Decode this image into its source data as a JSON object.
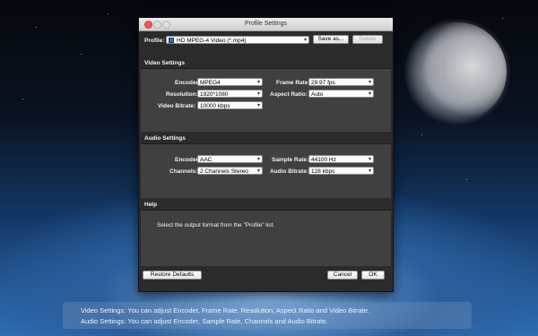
{
  "window": {
    "title": "Profile Settings"
  },
  "profile": {
    "label": "Profile:",
    "value": "HD MPEG-4 Video (*.mp4)",
    "save_as": "Save as...",
    "delete": "Delete"
  },
  "video": {
    "title": "Video Settings",
    "encoder_label": "Encoder:",
    "encoder": "MPEG4",
    "resolution_label": "Resolution:",
    "resolution": "1920*1080",
    "bitrate_label": "Video Bitrate:",
    "bitrate": "10000 kbps",
    "framerate_label": "Frame Rate:",
    "framerate": "29.97 fps",
    "aspect_label": "Aspect Ratio:",
    "aspect": "Auto"
  },
  "audio": {
    "title": "Audio Settings",
    "encoder_label": "Encoder:",
    "encoder": "AAC",
    "channels_label": "Channels:",
    "channels": "2 Channels Stereo",
    "samplerate_label": "Sample Rate:",
    "samplerate": "44100 Hz",
    "bitrate_label": "Audio Bitrate:",
    "bitrate": "128 kbps"
  },
  "help": {
    "title": "Help",
    "text": "Select the output format from the \"Profile\" list."
  },
  "footer": {
    "restore": "Restore Defaults",
    "cancel": "Cancel",
    "ok": "OK"
  },
  "caption": {
    "line1": "Video Settings: You can adjust Encoder, Frame Rate, Resolution, Aspect Ratio and Video Bitrate.",
    "line2": "Audio Settings: You can adjust Encoder, Sample Rate, Channels and Audio Bitrate."
  }
}
